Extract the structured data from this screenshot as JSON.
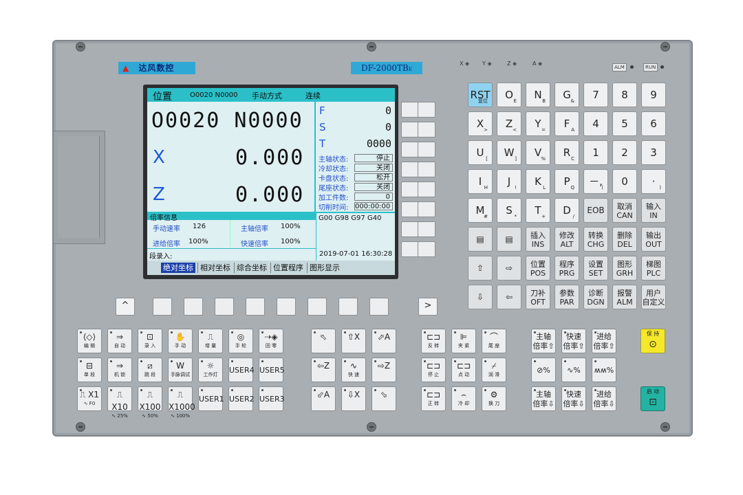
{
  "brand": {
    "name": "达风数控",
    "model": "DF-2000TB",
    "model_suffix": "E"
  },
  "indicators": {
    "axes": [
      "X",
      "Y",
      "Z",
      "A"
    ],
    "alm": "ALM",
    "run": "RUN"
  },
  "screen": {
    "header": {
      "title": "位置",
      "program": "O0020 N0000",
      "mode": "手动方式",
      "status": "连续"
    },
    "prog_big": "O0020 N0000",
    "x_label": "X",
    "x_val": "0.000",
    "z_label": "Z",
    "z_val": "0.000",
    "f_label": "F",
    "f_val": "0",
    "s_label": "S",
    "s_val": "0",
    "t_label": "T",
    "t_val": "0000",
    "status": [
      {
        "k": "主轴状态:",
        "v": "停止"
      },
      {
        "k": "冷却状态:",
        "v": "关闭"
      },
      {
        "k": "卡盘状态:",
        "v": "松开"
      },
      {
        "k": "尾座状态:",
        "v": "关闭"
      },
      {
        "k": "加工件数:",
        "v": "0"
      },
      {
        "k": "切削时间:",
        "v": "000:00:00"
      }
    ],
    "rate_title": "倍率信息",
    "rates": {
      "manual_k": "手动速率",
      "manual_v": "126",
      "spindle_k": "主轴倍率",
      "spindle_v": "100%",
      "feed_k": "进给倍率",
      "feed_v": "100%",
      "rapid_k": "快速倍率",
      "rapid_v": "100%"
    },
    "gcodes": "G00 G98 G97 G40",
    "input_label": "段录入:",
    "datetime": "2019-07-01  16:30:28",
    "tabs": [
      "绝对坐标",
      "相对坐标",
      "综合坐标",
      "位置程序",
      "图形显示"
    ]
  },
  "nav": {
    "up": "^",
    "right": ">"
  },
  "keypad": [
    [
      {
        "m": "RST",
        "s": "复位",
        "rst": true
      },
      {
        "m": "O",
        "s": "E"
      },
      {
        "m": "N",
        "s": "B"
      },
      {
        "m": "G",
        "s": "&"
      },
      {
        "m": "7"
      },
      {
        "m": "8"
      },
      {
        "m": "9"
      }
    ],
    [
      {
        "m": "X",
        "s": ">"
      },
      {
        "m": "Z",
        "s": "<"
      },
      {
        "m": "Y",
        "s": "="
      },
      {
        "m": "F",
        "s": "A"
      },
      {
        "m": "4"
      },
      {
        "m": "5"
      },
      {
        "m": "6"
      }
    ],
    [
      {
        "m": "U",
        "s": "["
      },
      {
        "m": "W",
        "s": "]"
      },
      {
        "m": "V",
        "s": "%"
      },
      {
        "m": "R",
        "s": "C"
      },
      {
        "m": "1"
      },
      {
        "m": "2"
      },
      {
        "m": "3"
      }
    ],
    [
      {
        "m": "I",
        "s": "H"
      },
      {
        "m": "J",
        "s": "!"
      },
      {
        "m": "K",
        "s": "L"
      },
      {
        "m": "P",
        "s": "Q"
      },
      {
        "m": "－,",
        "s": "("
      },
      {
        "m": "0"
      },
      {
        "m": "·",
        "s": ")"
      }
    ],
    [
      {
        "m": "M",
        "s": "#"
      },
      {
        "m": "S",
        "s": "*"
      },
      {
        "m": "T",
        "s": "+"
      },
      {
        "m": "D",
        "s": "/"
      },
      {
        "m": "EOB",
        "small": true
      },
      {
        "cn": "取消",
        "en": "CAN"
      },
      {
        "cn": "输入",
        "en": "IN"
      }
    ],
    [
      {
        "m": "▤",
        "small": true
      },
      {
        "m": "▤",
        "small": true
      },
      {
        "cn": "插入",
        "en": "INS"
      },
      {
        "cn": "修改",
        "en": "ALT"
      },
      {
        "cn": "转换",
        "en": "CHG"
      },
      {
        "cn": "删除",
        "en": "DEL"
      },
      {
        "cn": "输出",
        "en": "OUT"
      }
    ],
    [
      {
        "m": "⇧",
        "small": true
      },
      {
        "m": "⇨",
        "small": true
      },
      {
        "cn": "位置",
        "en": "POS"
      },
      {
        "cn": "程序",
        "en": "PRG"
      },
      {
        "cn": "设置",
        "en": "SET"
      },
      {
        "cn": "图形",
        "en": "GRH"
      },
      {
        "cn": "梯图",
        "en": "PLC"
      }
    ],
    [
      {
        "m": "⇩",
        "small": true
      },
      {
        "m": "⇦",
        "small": true
      },
      {
        "cn": "刀补",
        "en": "OFT"
      },
      {
        "cn": "参数",
        "en": "PAR"
      },
      {
        "cn": "诊断",
        "en": "DGN"
      },
      {
        "cn": "报警",
        "en": "ALM"
      },
      {
        "cn": "用户",
        "en": "自定义"
      }
    ]
  ],
  "mode_keys": [
    [
      {
        "i": "⟨◇⟩",
        "l": "编 辑"
      },
      {
        "i": "⇒",
        "l": "自 动"
      },
      {
        "i": "⊡",
        "l": "录 入"
      },
      {
        "i": "✋",
        "l": "手 动"
      },
      {
        "i": "⎍",
        "l": "增 量"
      },
      {
        "i": "◎",
        "l": "手 轮"
      },
      {
        "i": "⇢◈",
        "l": "回 零"
      }
    ],
    [
      {
        "i": "⊟",
        "l": "单 段"
      },
      {
        "i": "⇒",
        "l": "机 锁"
      },
      {
        "i": "⧄",
        "l": "跳 段"
      },
      {
        "i": "W",
        "l": "手脉调试"
      },
      {
        "i": "☼",
        "l": "工作灯"
      },
      {
        "t": "USER4"
      },
      {
        "t": "USER5"
      }
    ],
    [
      {
        "i": "⎍ X1",
        "l": "∿ F0"
      },
      {
        "i": "⎍ X10",
        "l": "∿ 25%"
      },
      {
        "i": "⎍ X100",
        "l": "∿ 50%"
      },
      {
        "i": "⎍ X1000",
        "l": "∿ 100%"
      },
      {
        "t": "USER1"
      },
      {
        "t": "USER2"
      },
      {
        "t": "USER3"
      }
    ]
  ],
  "jog_keys": [
    [
      {
        "i": "⬁",
        "l": ""
      },
      {
        "i": "⇧X",
        "l": ""
      },
      {
        "i": "⬀A",
        "l": ""
      }
    ],
    [
      {
        "i": "⇦Z",
        "l": ""
      },
      {
        "i": "∿",
        "l": "快 速"
      },
      {
        "i": "⇨Z",
        "l": ""
      }
    ],
    [
      {
        "i": "⬃A",
        "l": ""
      },
      {
        "i": "⇩X",
        "l": ""
      },
      {
        "i": "⬂",
        "l": ""
      }
    ]
  ],
  "aux_keys": [
    [
      {
        "i": "⊏⊐",
        "l": "反 转"
      },
      {
        "i": "⊫",
        "l": "夹 紧"
      },
      {
        "i": "⌒",
        "l": "尾 座"
      }
    ],
    [
      {
        "i": "⊏⊐",
        "l": "停 止"
      },
      {
        "i": "⊏⊐",
        "l": "点 动"
      },
      {
        "i": "⌿",
        "l": "润 滑"
      }
    ],
    [
      {
        "i": "⊏⊐",
        "l": "正 转"
      },
      {
        "i": "⌢",
        "l": "冷 却"
      },
      {
        "i": "⚙",
        "l": "换 刀"
      }
    ]
  ],
  "override_keys": [
    [
      {
        "t": "主轴\n倍率⇧"
      },
      {
        "t": "快速\n倍率⇧"
      },
      {
        "t": "进给\n倍率⇧"
      }
    ],
    [
      {
        "t": "⊘%"
      },
      {
        "t": "∿%"
      },
      {
        "t": "ʍʍ%"
      }
    ],
    [
      {
        "t": "主轴\n倍率⇩"
      },
      {
        "t": "快速\n倍率⇩"
      },
      {
        "t": "进给\n倍率⇩"
      }
    ]
  ],
  "cycle": {
    "hold": "保 持",
    "start": "启 动"
  },
  "colors": {
    "panel": "#a9aeb3",
    "lcd_bg": "#dff0f3",
    "lcd_accent": "#2bc0c8",
    "rst": "#8fd3f0",
    "hold": "#f5e82a",
    "start": "#23b3a3"
  }
}
